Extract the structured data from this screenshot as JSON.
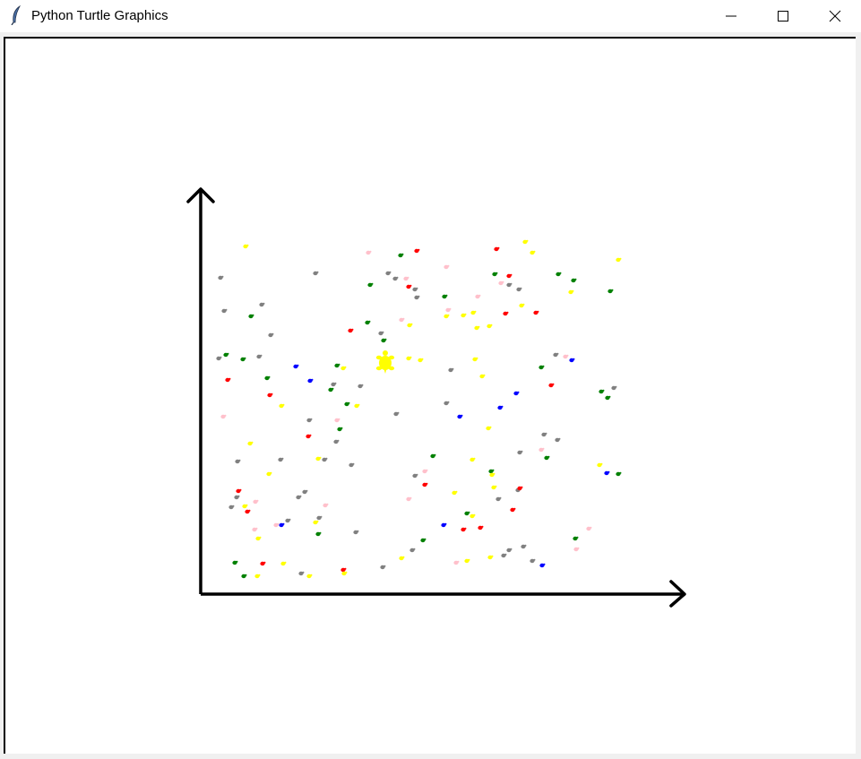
{
  "window": {
    "title": "Python Turtle Graphics",
    "icon": "feather-icon",
    "controls": [
      "minimize-icon",
      "maximize-icon",
      "close-icon"
    ]
  },
  "colors": {
    "canvas_background": "#ffffff",
    "axis": "#000000",
    "player_turtle": "#ffff00"
  },
  "chart_data": {
    "type": "scatter",
    "title": "",
    "xlabel": "",
    "ylabel": "",
    "grid": false,
    "axes": "arrows, no ticks",
    "player": {
      "shape": "turtle",
      "color": "#ffff00",
      "x": 430,
      "y": 405
    },
    "series": [
      {
        "color": "#808080",
        "x": [
          246,
          250,
          292,
          302,
          244,
          289,
          352,
          433,
          441,
          463,
          465,
          425,
          579,
          568,
          620,
          685,
          503,
          498,
          442,
          372,
          402,
          345,
          375,
          313,
          265,
          392,
          362,
          340,
          333,
          264,
          258,
          321,
          356,
          336,
          397,
          427,
          460,
          562,
          568,
          584,
          594,
          607,
          622,
          580,
          578,
          556,
          463
        ],
        "y": [
          310,
          347,
          340,
          374,
          400,
          398,
          305,
          305,
          311,
          323,
          332,
          372,
          323,
          318,
          396,
          433,
          413,
          450,
          462,
          429,
          431,
          469,
          493,
          513,
          515,
          519,
          513,
          549,
          555,
          555,
          566,
          581,
          578,
          640,
          594,
          633,
          614,
          620,
          614,
          610,
          626,
          485,
          491,
          505,
          547,
          557,
          531
        ]
      },
      {
        "color": "#ff0000",
        "x": [
          465,
          554,
          568,
          598,
          564,
          456,
          391,
          254,
          301,
          344,
          266,
          276,
          293,
          383,
          474,
          517,
          536,
          572,
          580,
          615
        ],
        "y": [
          280,
          278,
          308,
          349,
          350,
          320,
          369,
          424,
          441,
          487,
          548,
          571,
          629,
          636,
          541,
          591,
          589,
          569,
          545,
          430
        ]
      },
      {
        "color": "#008000",
        "x": [
          447,
          413,
          496,
          552,
          623,
          640,
          681,
          410,
          428,
          376,
          280,
          252,
          271,
          298,
          369,
          387,
          379,
          483,
          548,
          521,
          472,
          355,
          262,
          272,
          604,
          610,
          671,
          678,
          690,
          642
        ],
        "y": [
          285,
          318,
          331,
          306,
          306,
          313,
          325,
          360,
          380,
          408,
          353,
          396,
          401,
          422,
          435,
          451,
          479,
          509,
          526,
          573,
          603,
          596,
          628,
          643,
          410,
          511,
          437,
          444,
          529,
          601
        ]
      },
      {
        "color": "#0000ff",
        "x": [
          330,
          346,
          513,
          576,
          558,
          638,
          677,
          314,
          495,
          605
        ],
        "y": [
          409,
          425,
          465,
          439,
          455,
          402,
          528,
          586,
          586,
          631
        ]
      },
      {
        "color": "#ffff00",
        "x": [
          274,
          586,
          594,
          690,
          637,
          582,
          546,
          532,
          517,
          528,
          498,
          457,
          469,
          456,
          383,
          398,
          314,
          279,
          300,
          355,
          527,
          545,
          530,
          551,
          549,
          352,
          507,
          527,
          547,
          521,
          448,
          384,
          345,
          316,
          288,
          273,
          669,
          538,
          287
        ],
        "y": [
          275,
          270,
          282,
          290,
          326,
          341,
          364,
          366,
          352,
          349,
          353,
          363,
          402,
          400,
          411,
          453,
          453,
          495,
          529,
          512,
          513,
          478,
          401,
          544,
          530,
          583,
          550,
          576,
          622,
          626,
          623,
          640,
          643,
          629,
          601,
          565,
          519,
          420,
          643
        ]
      },
      {
        "color": "#ffc0cb",
        "x": [
          411,
          453,
          498,
          533,
          500,
          448,
          249,
          376,
          285,
          284,
          363,
          474,
          456,
          509,
          559,
          604,
          631,
          643,
          657,
          308
        ],
        "y": [
          282,
          311,
          298,
          331,
          346,
          357,
          465,
          469,
          560,
          591,
          564,
          526,
          557,
          628,
          316,
          502,
          398,
          613,
          590,
          586
        ]
      }
    ]
  }
}
